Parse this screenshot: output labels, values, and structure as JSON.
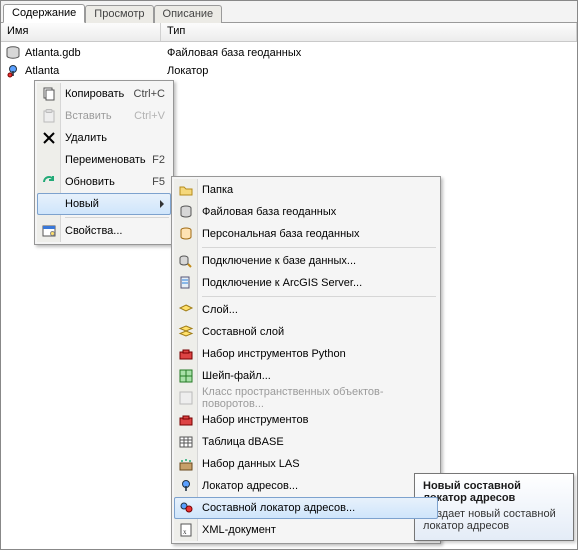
{
  "tabs": {
    "content": "Содержание",
    "preview": "Просмотр",
    "description": "Описание"
  },
  "columns": {
    "name": "Имя",
    "type": "Тип"
  },
  "rows": [
    {
      "name": "Atlanta.gdb",
      "type": "Файловая база геоданных",
      "icon": "gdb"
    },
    {
      "name": "Atlanta",
      "type": "Локатор",
      "icon": "locator"
    }
  ],
  "menu": {
    "copy": {
      "label": "Копировать",
      "shortcut": "Ctrl+C"
    },
    "paste": {
      "label": "Вставить",
      "shortcut": "Ctrl+V"
    },
    "delete": {
      "label": "Удалить"
    },
    "rename": {
      "label": "Переименовать",
      "shortcut": "F2"
    },
    "refresh": {
      "label": "Обновить",
      "shortcut": "F5"
    },
    "new": {
      "label": "Новый"
    },
    "props": {
      "label": "Свойства..."
    }
  },
  "submenu": {
    "folder": "Папка",
    "file_gdb": "Файловая база геоданных",
    "pers_gdb": "Персональная база геоданных",
    "db_conn": "Подключение к базе данных...",
    "ags_conn": "Подключение к ArcGIS Server...",
    "layer": "Слой...",
    "group_layer": "Составной слой",
    "py_toolbox": "Набор инструментов Python",
    "shapefile": "Шейп-файл...",
    "turn_fc": "Класс пространственных объектов-поворотов...",
    "toolbox": "Набор инструментов",
    "dbase": "Таблица dBASE",
    "las": "Набор данных LAS",
    "locator": "Локатор адресов...",
    "comp_locator": "Составной локатор адресов...",
    "xml": "XML-документ"
  },
  "tooltip": {
    "title": "Новый составной локатор адресов",
    "body": "Создает новый составной локатор адресов"
  }
}
